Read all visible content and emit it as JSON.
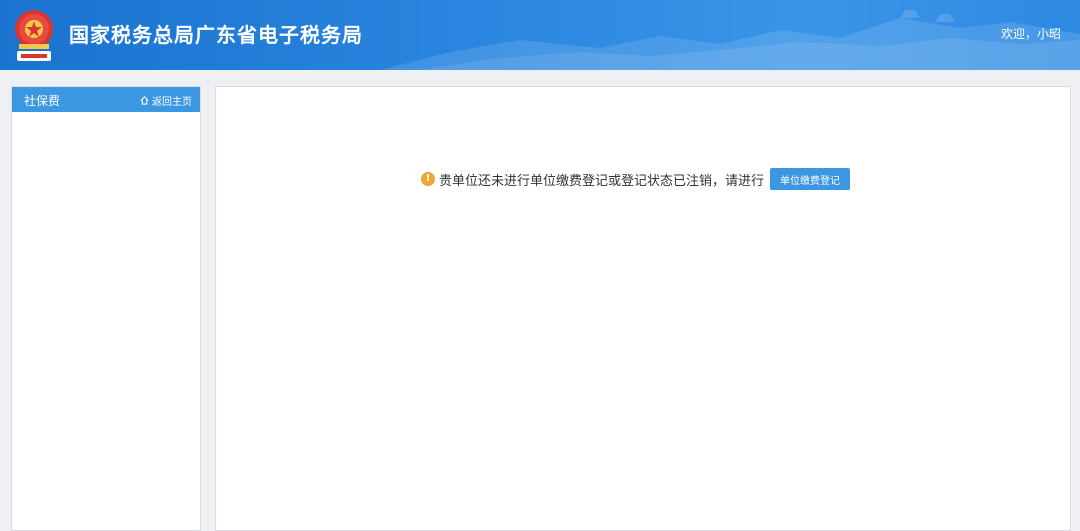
{
  "header": {
    "site_title": "国家税务总局广东省电子税务局",
    "welcome": "欢迎，小昭"
  },
  "sidebar": {
    "title": "社保费",
    "home_link": "返回主页"
  },
  "main": {
    "notice_text": "贵单位还未进行单位缴费登记或登记状态已注销，请进行",
    "register_button": "单位缴费登记"
  },
  "colors": {
    "header_blue": "#2a86e0",
    "sidebar_header": "#3c97e3",
    "warning": "#f0a534",
    "button": "#3c97e3"
  },
  "icons": {
    "emblem": "tax-emblem-icon",
    "home": "home-icon",
    "warning": "warning-icon"
  }
}
